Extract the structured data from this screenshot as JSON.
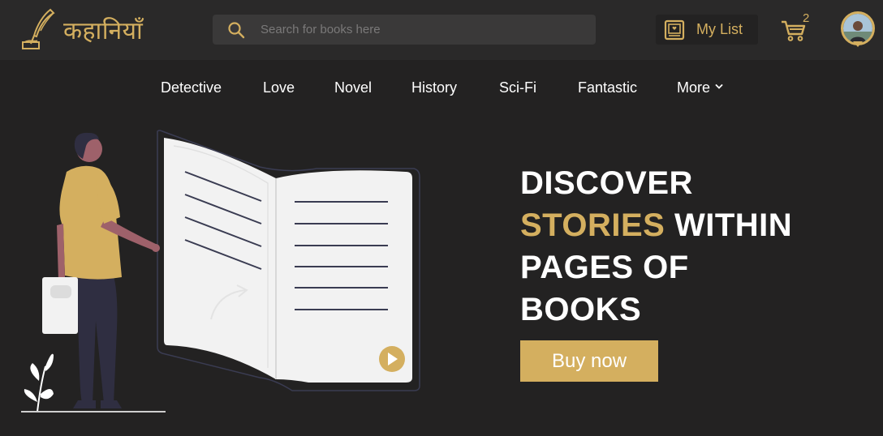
{
  "brand": {
    "name": "कहानियाँ",
    "logo_icon": "quill-pen-icon"
  },
  "search": {
    "placeholder": "Search for books here",
    "value": ""
  },
  "header": {
    "mylist_label": "My List",
    "mylist_icon": "bookmark-book-icon",
    "cart_count": "2",
    "cart_icon": "cart-icon"
  },
  "categories": [
    {
      "label": "Detective"
    },
    {
      "label": "Love"
    },
    {
      "label": "Novel"
    },
    {
      "label": "History"
    },
    {
      "label": "Sci-Fi"
    },
    {
      "label": "Fantastic"
    },
    {
      "label": "More"
    }
  ],
  "hero": {
    "headline_1": "DISCOVER",
    "headline_accent": "STORIES",
    "headline_2": " WITHIN",
    "headline_3": "PAGES OF",
    "headline_4": "BOOKS",
    "button_label": "Buy now"
  },
  "colors": {
    "background": "#232222",
    "header": "#2a2929",
    "accent": "#d4af5f",
    "search_bg": "#3a3939",
    "text": "#ffffff"
  }
}
